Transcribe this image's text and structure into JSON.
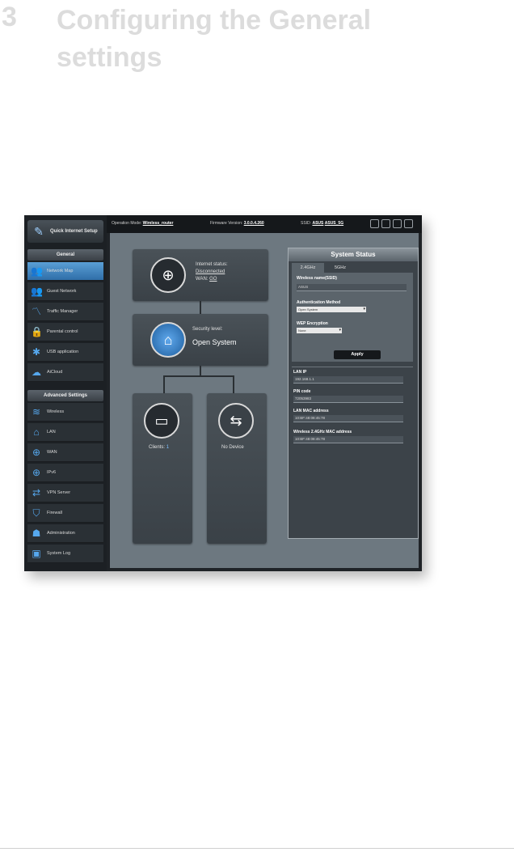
{
  "chapter": {
    "number": "3",
    "title": "Configuring the General settings"
  },
  "topbar": {
    "operation_mode_label": "Operation Mode:",
    "operation_mode_value": "Wireless_router",
    "firmware_label": "Firmware Version:",
    "firmware_value": "3.0.0.4.260",
    "ssid_label": "SSID:",
    "ssid_2g": "ASUS",
    "ssid_5g": "ASUS_5G"
  },
  "sidebar": {
    "quick_setup": "Quick Internet Setup",
    "general_header": "General",
    "general_items": [
      {
        "label": "Network Map",
        "icon": "network-map-icon",
        "glyph": "👥"
      },
      {
        "label": "Guest Network",
        "icon": "guest-network-icon",
        "glyph": "👥"
      },
      {
        "label": "Traffic Manager",
        "icon": "traffic-manager-icon",
        "glyph": "〽"
      },
      {
        "label": "Parental control",
        "icon": "parental-control-icon",
        "glyph": "🔒"
      },
      {
        "label": "USB application",
        "icon": "usb-application-icon",
        "glyph": "✱"
      },
      {
        "label": "AiCloud",
        "icon": "aicloud-icon",
        "glyph": "☁"
      }
    ],
    "advanced_header": "Advanced Settings",
    "advanced_items": [
      {
        "label": "Wireless",
        "icon": "wireless-icon",
        "glyph": "≋"
      },
      {
        "label": "LAN",
        "icon": "lan-icon",
        "glyph": "⌂"
      },
      {
        "label": "WAN",
        "icon": "wan-icon",
        "glyph": "⊕"
      },
      {
        "label": "IPv6",
        "icon": "ipv6-icon",
        "glyph": "⊕"
      },
      {
        "label": "VPN Server",
        "icon": "vpn-server-icon",
        "glyph": "⇄"
      },
      {
        "label": "Firewall",
        "icon": "firewall-icon",
        "glyph": "⛉"
      },
      {
        "label": "Administration",
        "icon": "administration-icon",
        "glyph": "☗"
      },
      {
        "label": "System Log",
        "icon": "system-log-icon",
        "glyph": "▣"
      }
    ]
  },
  "map": {
    "internet_status_label": "Internet status:",
    "internet_status_value": "Disconnected",
    "wan_ip_label": "WAN:",
    "wan_ip_value": "GO",
    "security_label": "Security level:",
    "security_value": "Open System",
    "clients_label": "Clients:",
    "clients_value": "1",
    "usb_label": "No Device"
  },
  "status": {
    "title": "System Status",
    "tab_24": "2.4GHz",
    "tab_5": "5GHz",
    "ssid_label": "Wireless name(SSID)",
    "ssid_value": "ASUS",
    "auth_label": "Authentication Method",
    "auth_value": "Open System",
    "wep_label": "WEP Encryption",
    "wep_value": "None",
    "apply": "Apply",
    "lan_ip_label": "LAN IP",
    "lan_ip_value": "192.168.1.1",
    "pin_label": "PIN code",
    "pin_value": "72053983",
    "lan_mac_label": "LAN MAC address",
    "lan_mac_value": "10:BF:48:08:45:78",
    "wl_mac_label": "Wireless 2.4GHz MAC address",
    "wl_mac_value": "10:BF:48:08:45:78"
  }
}
